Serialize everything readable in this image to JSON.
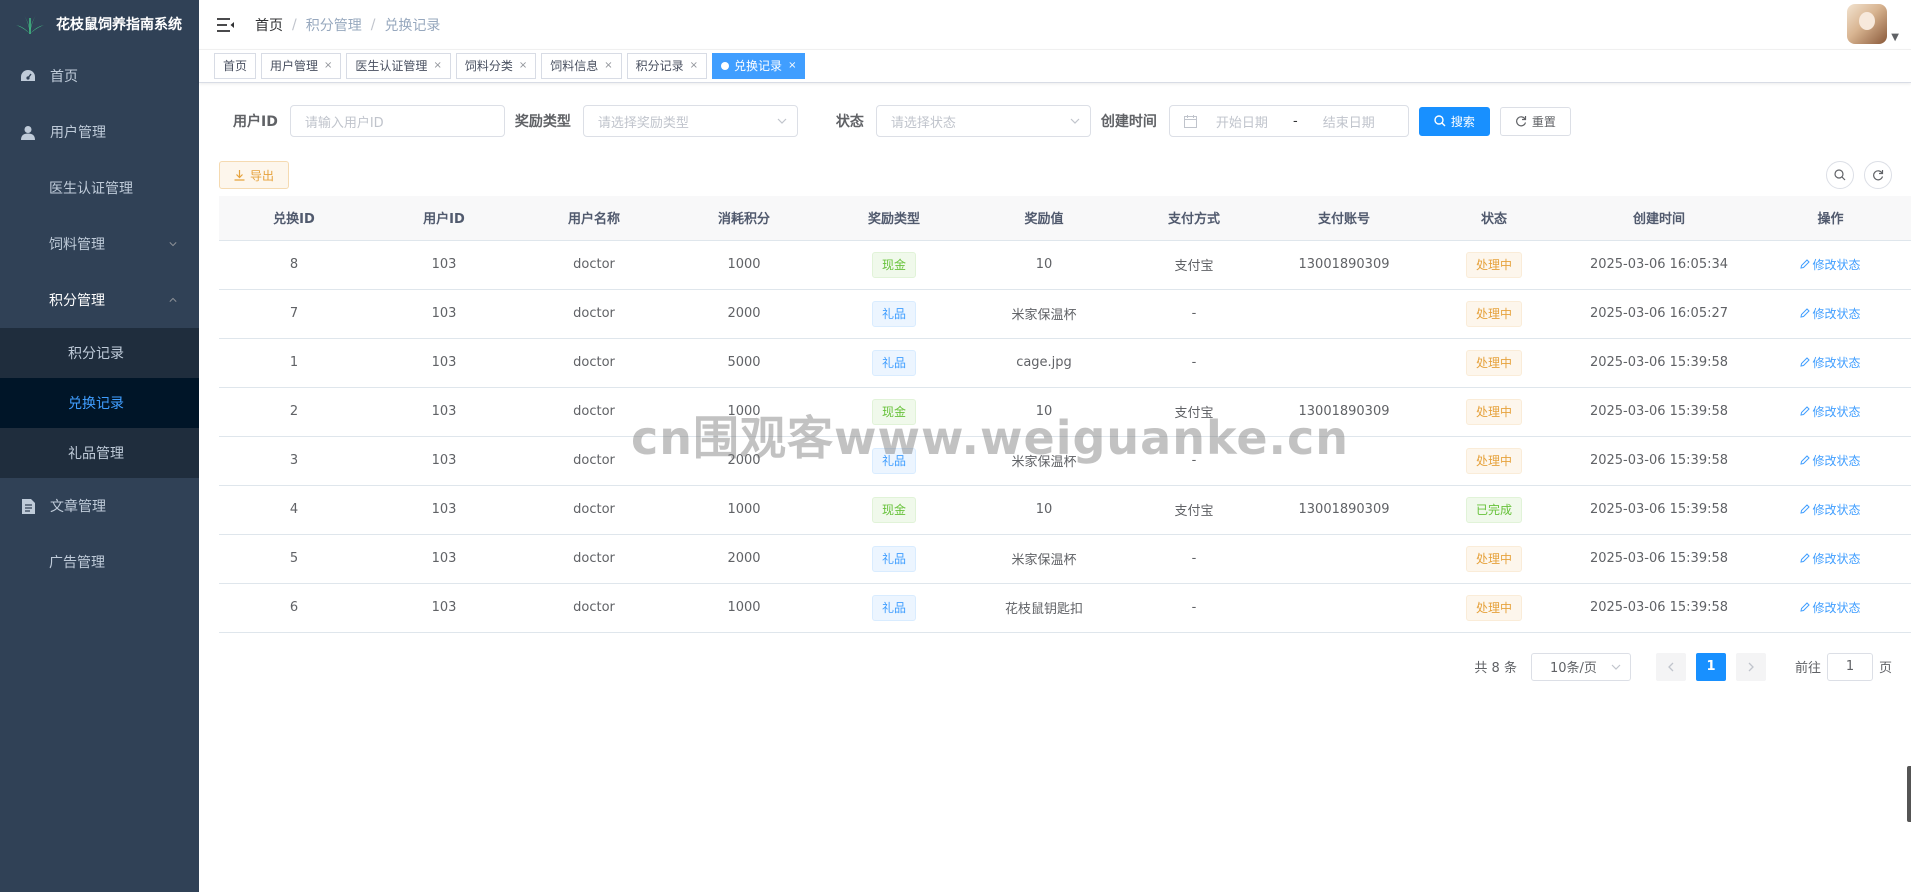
{
  "app": {
    "title": "花枝鼠饲养指南系统"
  },
  "sidebar": {
    "items": [
      {
        "label": "首页",
        "icon": "dashboard-icon"
      },
      {
        "label": "用户管理",
        "icon": "user-icon"
      },
      {
        "label": "医生认证管理",
        "icon": ""
      },
      {
        "label": "饲料管理",
        "icon": ""
      },
      {
        "label": "积分管理",
        "icon": ""
      },
      {
        "label": "文章管理",
        "icon": "document-icon"
      },
      {
        "label": "广告管理",
        "icon": ""
      }
    ],
    "submenu": [
      {
        "label": "积分记录"
      },
      {
        "label": "兑换记录",
        "active": true
      },
      {
        "label": "礼品管理"
      }
    ]
  },
  "breadcrumb": [
    "首页",
    "积分管理",
    "兑换记录"
  ],
  "tags": [
    {
      "label": "首页"
    },
    {
      "label": "用户管理"
    },
    {
      "label": "医生认证管理"
    },
    {
      "label": "饲料分类"
    },
    {
      "label": "饲料信息"
    },
    {
      "label": "积分记录"
    },
    {
      "label": "兑换记录",
      "active": true
    }
  ],
  "search": {
    "user_id_label": "用户ID",
    "user_id_placeholder": "请输入用户ID",
    "reward_type_label": "奖励类型",
    "reward_type_placeholder": "请选择奖励类型",
    "status_label": "状态",
    "status_placeholder": "请选择状态",
    "created_label": "创建时间",
    "start_placeholder": "开始日期",
    "range_sep": "-",
    "end_placeholder": "结束日期",
    "search_btn": "搜索",
    "reset_btn": "重置"
  },
  "toolbar": {
    "export_btn": "导出"
  },
  "table": {
    "columns": [
      "兑换ID",
      "用户ID",
      "用户名称",
      "消耗积分",
      "奖励类型",
      "奖励值",
      "支付方式",
      "支付账号",
      "状态",
      "创建时间",
      "操作"
    ],
    "action_label": "修改状态",
    "rows": [
      {
        "id": "8",
        "uid": "103",
        "name": "doctor",
        "points": "1000",
        "type": "现金",
        "type_color": "green",
        "value": "10",
        "pay": "支付宝",
        "account": "13001890309",
        "status": "处理中",
        "status_color": "orange",
        "created": "2025-03-06 16:05:34"
      },
      {
        "id": "7",
        "uid": "103",
        "name": "doctor",
        "points": "2000",
        "type": "礼品",
        "type_color": "blue",
        "value": "米家保温杯",
        "pay": "-",
        "account": "",
        "status": "处理中",
        "status_color": "orange",
        "created": "2025-03-06 16:05:27"
      },
      {
        "id": "1",
        "uid": "103",
        "name": "doctor",
        "points": "5000",
        "type": "礼品",
        "type_color": "blue",
        "value": "cage.jpg",
        "pay": "-",
        "account": "",
        "status": "处理中",
        "status_color": "orange",
        "created": "2025-03-06 15:39:58"
      },
      {
        "id": "2",
        "uid": "103",
        "name": "doctor",
        "points": "1000",
        "type": "现金",
        "type_color": "green",
        "value": "10",
        "pay": "支付宝",
        "account": "13001890309",
        "status": "处理中",
        "status_color": "orange",
        "created": "2025-03-06 15:39:58"
      },
      {
        "id": "3",
        "uid": "103",
        "name": "doctor",
        "points": "2000",
        "type": "礼品",
        "type_color": "blue",
        "value": "米家保温杯",
        "pay": "-",
        "account": "",
        "status": "处理中",
        "status_color": "orange",
        "created": "2025-03-06 15:39:58"
      },
      {
        "id": "4",
        "uid": "103",
        "name": "doctor",
        "points": "1000",
        "type": "现金",
        "type_color": "green",
        "value": "10",
        "pay": "支付宝",
        "account": "13001890309",
        "status": "已完成",
        "status_color": "green",
        "created": "2025-03-06 15:39:58"
      },
      {
        "id": "5",
        "uid": "103",
        "name": "doctor",
        "points": "2000",
        "type": "礼品",
        "type_color": "blue",
        "value": "米家保温杯",
        "pay": "-",
        "account": "",
        "status": "处理中",
        "status_color": "orange",
        "created": "2025-03-06 15:39:58"
      },
      {
        "id": "6",
        "uid": "103",
        "name": "doctor",
        "points": "1000",
        "type": "礼品",
        "type_color": "blue",
        "value": "花枝鼠钥匙扣",
        "pay": "-",
        "account": "",
        "status": "处理中",
        "status_color": "orange",
        "created": "2025-03-06 15:39:58"
      }
    ]
  },
  "pagination": {
    "total_text": "共 8 条",
    "page_size": "10条/页",
    "current_page": "1",
    "goto_label": "前往",
    "goto_value": "1",
    "page_suffix": "页"
  },
  "watermark": "cn围观客www.weiguanke.cn",
  "colors": {
    "sidebar_bg": "#304156",
    "primary": "#1890ff",
    "active_submenu_bg": "#001528"
  }
}
